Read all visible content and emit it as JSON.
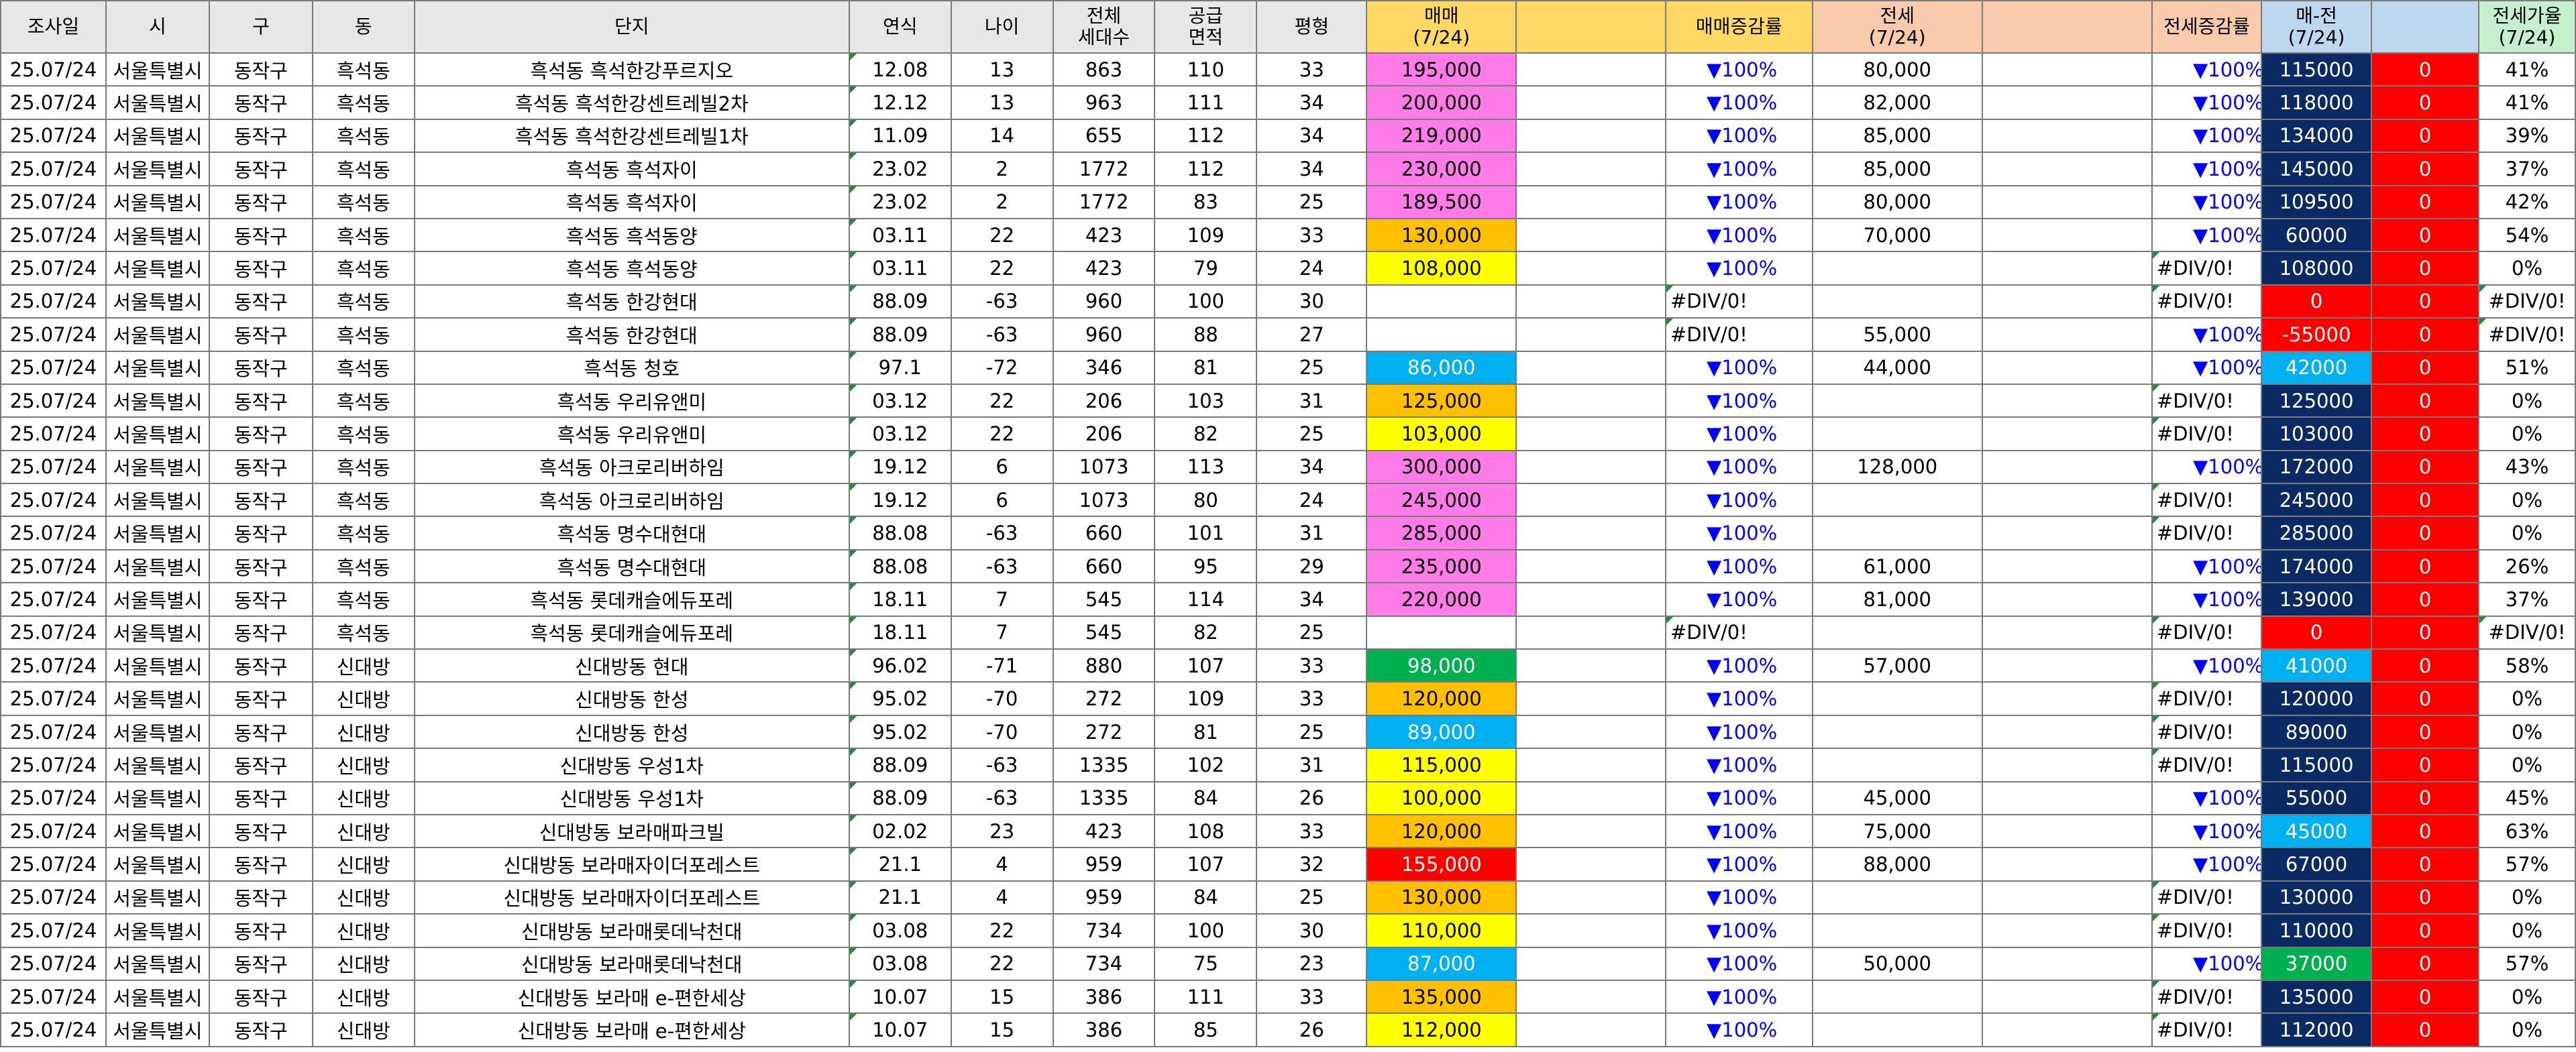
{
  "headers": [
    "조사일",
    "시",
    "구",
    "동",
    "단지",
    "연식",
    "나이",
    "전체\n세대수",
    "공급\n면적",
    "평형",
    "매매\n(7/24)",
    "",
    "매매증감률",
    "전세\n(7/24)",
    "",
    "전세증감률",
    "매-전\n(7/24)",
    "",
    "전세가율\n(7/24)"
  ],
  "colors": {
    "pink": "#ff7ce8",
    "orange": "#ffc000",
    "yellow": "#ffff00",
    "sky": "#00b0f0",
    "green": "#00b050",
    "red": "#ff0000",
    "navy": "#0b2a63"
  },
  "rows": [
    {
      "date": "25.07/24",
      "city": "서울특별시",
      "gu": "동작구",
      "dong": "흑석동",
      "complex": "흑석동 흑석한강푸르지오",
      "year": "12.08",
      "age": "13",
      "households": "863",
      "area": "110",
      "pyeong": "33",
      "sale": "195,000",
      "sale_color": "pink",
      "sale_change": "▼100%",
      "jeonse": "80,000",
      "jeonse_change": "▼100%",
      "gap": "115000",
      "gap_color": "navy",
      "zero": "0",
      "ratio": "41%"
    },
    {
      "date": "25.07/24",
      "city": "서울특별시",
      "gu": "동작구",
      "dong": "흑석동",
      "complex": "흑석동 흑석한강센트레빌2차",
      "year": "12.12",
      "age": "13",
      "households": "963",
      "area": "111",
      "pyeong": "34",
      "sale": "200,000",
      "sale_color": "pink",
      "sale_change": "▼100%",
      "jeonse": "82,000",
      "jeonse_change": "▼100%",
      "gap": "118000",
      "gap_color": "navy",
      "zero": "0",
      "ratio": "41%"
    },
    {
      "date": "25.07/24",
      "city": "서울특별시",
      "gu": "동작구",
      "dong": "흑석동",
      "complex": "흑석동 흑석한강센트레빌1차",
      "year": "11.09",
      "age": "14",
      "households": "655",
      "area": "112",
      "pyeong": "34",
      "sale": "219,000",
      "sale_color": "pink",
      "sale_change": "▼100%",
      "jeonse": "85,000",
      "jeonse_change": "▼100%",
      "gap": "134000",
      "gap_color": "navy",
      "zero": "0",
      "ratio": "39%"
    },
    {
      "date": "25.07/24",
      "city": "서울특별시",
      "gu": "동작구",
      "dong": "흑석동",
      "complex": "흑석동 흑석자이",
      "year": "23.02",
      "age": "2",
      "households": "1772",
      "area": "112",
      "pyeong": "34",
      "sale": "230,000",
      "sale_color": "pink",
      "sale_change": "▼100%",
      "jeonse": "85,000",
      "jeonse_change": "▼100%",
      "gap": "145000",
      "gap_color": "navy",
      "zero": "0",
      "ratio": "37%"
    },
    {
      "date": "25.07/24",
      "city": "서울특별시",
      "gu": "동작구",
      "dong": "흑석동",
      "complex": "흑석동 흑석자이",
      "year": "23.02",
      "age": "2",
      "households": "1772",
      "area": "83",
      "pyeong": "25",
      "sale": "189,500",
      "sale_color": "pink",
      "sale_change": "▼100%",
      "jeonse": "80,000",
      "jeonse_change": "▼100%",
      "gap": "109500",
      "gap_color": "navy",
      "zero": "0",
      "ratio": "42%"
    },
    {
      "date": "25.07/24",
      "city": "서울특별시",
      "gu": "동작구",
      "dong": "흑석동",
      "complex": "흑석동 흑석동양",
      "year": "03.11",
      "age": "22",
      "households": "423",
      "area": "109",
      "pyeong": "33",
      "sale": "130,000",
      "sale_color": "orange",
      "sale_change": "▼100%",
      "jeonse": "70,000",
      "jeonse_change": "▼100%",
      "gap": "60000",
      "gap_color": "navy",
      "zero": "0",
      "ratio": "54%"
    },
    {
      "date": "25.07/24",
      "city": "서울특별시",
      "gu": "동작구",
      "dong": "흑석동",
      "complex": "흑석동 흑석동양",
      "year": "03.11",
      "age": "22",
      "households": "423",
      "area": "79",
      "pyeong": "24",
      "sale": "108,000",
      "sale_color": "yellow",
      "sale_change": "▼100%",
      "jeonse": "",
      "jeonse_change": "#DIV/0!",
      "gap": "108000",
      "gap_color": "navy",
      "zero": "0",
      "ratio": "0%"
    },
    {
      "date": "25.07/24",
      "city": "서울특별시",
      "gu": "동작구",
      "dong": "흑석동",
      "complex": "흑석동 한강현대",
      "year": "88.09",
      "age": "-63",
      "households": "960",
      "area": "100",
      "pyeong": "30",
      "sale": "",
      "sale_color": "none",
      "sale_change": "#DIV/0!",
      "jeonse": "",
      "jeonse_change": "#DIV/0!",
      "gap": "0",
      "gap_color": "red",
      "zero": "0",
      "ratio": "#DIV/0!"
    },
    {
      "date": "25.07/24",
      "city": "서울특별시",
      "gu": "동작구",
      "dong": "흑석동",
      "complex": "흑석동 한강현대",
      "year": "88.09",
      "age": "-63",
      "households": "960",
      "area": "88",
      "pyeong": "27",
      "sale": "",
      "sale_color": "none",
      "sale_change": "#DIV/0!",
      "jeonse": "55,000",
      "jeonse_change": "▼100%",
      "gap": "-55000",
      "gap_color": "red",
      "zero": "0",
      "ratio": "#DIV/0!"
    },
    {
      "date": "25.07/24",
      "city": "서울특별시",
      "gu": "동작구",
      "dong": "흑석동",
      "complex": "흑석동 청호",
      "year": "97.1",
      "age": "-72",
      "households": "346",
      "area": "81",
      "pyeong": "25",
      "sale": "86,000",
      "sale_color": "sky",
      "sale_change": "▼100%",
      "jeonse": "44,000",
      "jeonse_change": "▼100%",
      "gap": "42000",
      "gap_color": "sky",
      "zero": "0",
      "ratio": "51%"
    },
    {
      "date": "25.07/24",
      "city": "서울특별시",
      "gu": "동작구",
      "dong": "흑석동",
      "complex": "흑석동 우리유앤미",
      "year": "03.12",
      "age": "22",
      "households": "206",
      "area": "103",
      "pyeong": "31",
      "sale": "125,000",
      "sale_color": "orange",
      "sale_change": "▼100%",
      "jeonse": "",
      "jeonse_change": "#DIV/0!",
      "gap": "125000",
      "gap_color": "navy",
      "zero": "0",
      "ratio": "0%"
    },
    {
      "date": "25.07/24",
      "city": "서울특별시",
      "gu": "동작구",
      "dong": "흑석동",
      "complex": "흑석동 우리유앤미",
      "year": "03.12",
      "age": "22",
      "households": "206",
      "area": "82",
      "pyeong": "25",
      "sale": "103,000",
      "sale_color": "yellow",
      "sale_change": "▼100%",
      "jeonse": "",
      "jeonse_change": "#DIV/0!",
      "gap": "103000",
      "gap_color": "navy",
      "zero": "0",
      "ratio": "0%"
    },
    {
      "date": "25.07/24",
      "city": "서울특별시",
      "gu": "동작구",
      "dong": "흑석동",
      "complex": "흑석동 아크로리버하임",
      "year": "19.12",
      "age": "6",
      "households": "1073",
      "area": "113",
      "pyeong": "34",
      "sale": "300,000",
      "sale_color": "pink",
      "sale_change": "▼100%",
      "jeonse": "128,000",
      "jeonse_change": "▼100%",
      "gap": "172000",
      "gap_color": "navy",
      "zero": "0",
      "ratio": "43%"
    },
    {
      "date": "25.07/24",
      "city": "서울특별시",
      "gu": "동작구",
      "dong": "흑석동",
      "complex": "흑석동 아크로리버하임",
      "year": "19.12",
      "age": "6",
      "households": "1073",
      "area": "80",
      "pyeong": "24",
      "sale": "245,000",
      "sale_color": "pink",
      "sale_change": "▼100%",
      "jeonse": "",
      "jeonse_change": "#DIV/0!",
      "gap": "245000",
      "gap_color": "navy",
      "zero": "0",
      "ratio": "0%"
    },
    {
      "date": "25.07/24",
      "city": "서울특별시",
      "gu": "동작구",
      "dong": "흑석동",
      "complex": "흑석동 명수대현대",
      "year": "88.08",
      "age": "-63",
      "households": "660",
      "area": "101",
      "pyeong": "31",
      "sale": "285,000",
      "sale_color": "pink",
      "sale_change": "▼100%",
      "jeonse": "",
      "jeonse_change": "#DIV/0!",
      "gap": "285000",
      "gap_color": "navy",
      "zero": "0",
      "ratio": "0%"
    },
    {
      "date": "25.07/24",
      "city": "서울특별시",
      "gu": "동작구",
      "dong": "흑석동",
      "complex": "흑석동 명수대현대",
      "year": "88.08",
      "age": "-63",
      "households": "660",
      "area": "95",
      "pyeong": "29",
      "sale": "235,000",
      "sale_color": "pink",
      "sale_change": "▼100%",
      "jeonse": "61,000",
      "jeonse_change": "▼100%",
      "gap": "174000",
      "gap_color": "navy",
      "zero": "0",
      "ratio": "26%"
    },
    {
      "date": "25.07/24",
      "city": "서울특별시",
      "gu": "동작구",
      "dong": "흑석동",
      "complex": "흑석동 롯데캐슬에듀포레",
      "year": "18.11",
      "age": "7",
      "households": "545",
      "area": "114",
      "pyeong": "34",
      "sale": "220,000",
      "sale_color": "pink",
      "sale_change": "▼100%",
      "jeonse": "81,000",
      "jeonse_change": "▼100%",
      "gap": "139000",
      "gap_color": "navy",
      "zero": "0",
      "ratio": "37%"
    },
    {
      "date": "25.07/24",
      "city": "서울특별시",
      "gu": "동작구",
      "dong": "흑석동",
      "complex": "흑석동 롯데캐슬에듀포레",
      "year": "18.11",
      "age": "7",
      "households": "545",
      "area": "82",
      "pyeong": "25",
      "sale": "",
      "sale_color": "none",
      "sale_change": "#DIV/0!",
      "jeonse": "",
      "jeonse_change": "#DIV/0!",
      "gap": "0",
      "gap_color": "red",
      "zero": "0",
      "ratio": "#DIV/0!"
    },
    {
      "date": "25.07/24",
      "city": "서울특별시",
      "gu": "동작구",
      "dong": "신대방",
      "complex": "신대방동 현대",
      "year": "96.02",
      "age": "-71",
      "households": "880",
      "area": "107",
      "pyeong": "33",
      "sale": "98,000",
      "sale_color": "green",
      "sale_change": "▼100%",
      "jeonse": "57,000",
      "jeonse_change": "▼100%",
      "gap": "41000",
      "gap_color": "sky",
      "zero": "0",
      "ratio": "58%"
    },
    {
      "date": "25.07/24",
      "city": "서울특별시",
      "gu": "동작구",
      "dong": "신대방",
      "complex": "신대방동 한성",
      "year": "95.02",
      "age": "-70",
      "households": "272",
      "area": "109",
      "pyeong": "33",
      "sale": "120,000",
      "sale_color": "orange",
      "sale_change": "▼100%",
      "jeonse": "",
      "jeonse_change": "#DIV/0!",
      "gap": "120000",
      "gap_color": "navy",
      "zero": "0",
      "ratio": "0%"
    },
    {
      "date": "25.07/24",
      "city": "서울특별시",
      "gu": "동작구",
      "dong": "신대방",
      "complex": "신대방동 한성",
      "year": "95.02",
      "age": "-70",
      "households": "272",
      "area": "81",
      "pyeong": "25",
      "sale": "89,000",
      "sale_color": "sky",
      "sale_change": "▼100%",
      "jeonse": "",
      "jeonse_change": "#DIV/0!",
      "gap": "89000",
      "gap_color": "navy",
      "zero": "0",
      "ratio": "0%"
    },
    {
      "date": "25.07/24",
      "city": "서울특별시",
      "gu": "동작구",
      "dong": "신대방",
      "complex": "신대방동 우성1차",
      "year": "88.09",
      "age": "-63",
      "households": "1335",
      "area": "102",
      "pyeong": "31",
      "sale": "115,000",
      "sale_color": "yellow",
      "sale_change": "▼100%",
      "jeonse": "",
      "jeonse_change": "#DIV/0!",
      "gap": "115000",
      "gap_color": "navy",
      "zero": "0",
      "ratio": "0%"
    },
    {
      "date": "25.07/24",
      "city": "서울특별시",
      "gu": "동작구",
      "dong": "신대방",
      "complex": "신대방동 우성1차",
      "year": "88.09",
      "age": "-63",
      "households": "1335",
      "area": "84",
      "pyeong": "26",
      "sale": "100,000",
      "sale_color": "yellow",
      "sale_change": "▼100%",
      "jeonse": "45,000",
      "jeonse_change": "▼100%",
      "gap": "55000",
      "gap_color": "navy",
      "zero": "0",
      "ratio": "45%"
    },
    {
      "date": "25.07/24",
      "city": "서울특별시",
      "gu": "동작구",
      "dong": "신대방",
      "complex": "신대방동 보라매파크빌",
      "year": "02.02",
      "age": "23",
      "households": "423",
      "area": "108",
      "pyeong": "33",
      "sale": "120,000",
      "sale_color": "orange",
      "sale_change": "▼100%",
      "jeonse": "75,000",
      "jeonse_change": "▼100%",
      "gap": "45000",
      "gap_color": "sky",
      "zero": "0",
      "ratio": "63%"
    },
    {
      "date": "25.07/24",
      "city": "서울특별시",
      "gu": "동작구",
      "dong": "신대방",
      "complex": "신대방동 보라매자이더포레스트",
      "year": "21.1",
      "age": "4",
      "households": "959",
      "area": "107",
      "pyeong": "32",
      "sale": "155,000",
      "sale_color": "red",
      "sale_change": "▼100%",
      "jeonse": "88,000",
      "jeonse_change": "▼100%",
      "gap": "67000",
      "gap_color": "navy",
      "zero": "0",
      "ratio": "57%"
    },
    {
      "date": "25.07/24",
      "city": "서울특별시",
      "gu": "동작구",
      "dong": "신대방",
      "complex": "신대방동 보라매자이더포레스트",
      "year": "21.1",
      "age": "4",
      "households": "959",
      "area": "84",
      "pyeong": "25",
      "sale": "130,000",
      "sale_color": "orange",
      "sale_change": "▼100%",
      "jeonse": "",
      "jeonse_change": "#DIV/0!",
      "gap": "130000",
      "gap_color": "navy",
      "zero": "0",
      "ratio": "0%"
    },
    {
      "date": "25.07/24",
      "city": "서울특별시",
      "gu": "동작구",
      "dong": "신대방",
      "complex": "신대방동 보라매롯데낙천대",
      "year": "03.08",
      "age": "22",
      "households": "734",
      "area": "100",
      "pyeong": "30",
      "sale": "110,000",
      "sale_color": "yellow",
      "sale_change": "▼100%",
      "jeonse": "",
      "jeonse_change": "#DIV/0!",
      "gap": "110000",
      "gap_color": "navy",
      "zero": "0",
      "ratio": "0%"
    },
    {
      "date": "25.07/24",
      "city": "서울특별시",
      "gu": "동작구",
      "dong": "신대방",
      "complex": "신대방동 보라매롯데낙천대",
      "year": "03.08",
      "age": "22",
      "households": "734",
      "area": "75",
      "pyeong": "23",
      "sale": "87,000",
      "sale_color": "sky",
      "sale_change": "▼100%",
      "jeonse": "50,000",
      "jeonse_change": "▼100%",
      "gap": "37000",
      "gap_color": "green",
      "zero": "0",
      "ratio": "57%"
    },
    {
      "date": "25.07/24",
      "city": "서울특별시",
      "gu": "동작구",
      "dong": "신대방",
      "complex": "신대방동 보라매 e-편한세상",
      "year": "10.07",
      "age": "15",
      "households": "386",
      "area": "111",
      "pyeong": "33",
      "sale": "135,000",
      "sale_color": "orange",
      "sale_change": "▼100%",
      "jeonse": "",
      "jeonse_change": "#DIV/0!",
      "gap": "135000",
      "gap_color": "navy",
      "zero": "0",
      "ratio": "0%"
    },
    {
      "date": "25.07/24",
      "city": "서울특별시",
      "gu": "동작구",
      "dong": "신대방",
      "complex": "신대방동 보라매 e-편한세상",
      "year": "10.07",
      "age": "15",
      "households": "386",
      "area": "85",
      "pyeong": "26",
      "sale": "112,000",
      "sale_color": "yellow",
      "sale_change": "▼100%",
      "jeonse": "",
      "jeonse_change": "#DIV/0!",
      "gap": "112000",
      "gap_color": "navy",
      "zero": "0",
      "ratio": "0%"
    }
  ]
}
